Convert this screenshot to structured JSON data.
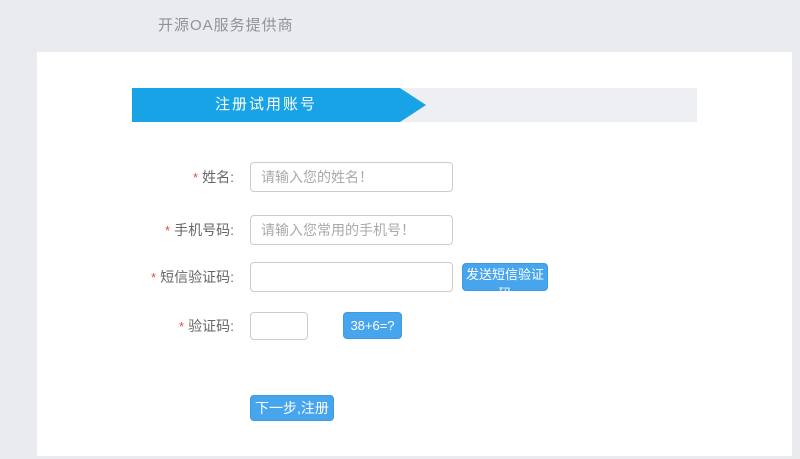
{
  "header": {
    "brand": "开源OA服务提供商"
  },
  "banner": {
    "title": "注册试用账号"
  },
  "form": {
    "fields": [
      {
        "required": "*",
        "label": "姓名:",
        "placeholder": "请输入您的姓名！"
      },
      {
        "required": "*",
        "label": "手机号码:",
        "placeholder": "请输入您常用的手机号！"
      },
      {
        "required": "*",
        "label": "短信验证码:",
        "placeholder": "",
        "action_label": "发送短信验证码"
      },
      {
        "required": "*",
        "label": "验证码:",
        "placeholder": "",
        "captcha_label": "38+6=?"
      }
    ],
    "submit_label": "下一步,注册"
  },
  "colors": {
    "page_background": "#e9ebee",
    "panel_background": "#ffffff",
    "banner_track": "#edeff2",
    "banner_blue": "#17a3e6",
    "button_blue": "#47a5ee",
    "required_red": "#d9534f",
    "label_gray": "#666666",
    "brand_gray": "#8e939b"
  }
}
